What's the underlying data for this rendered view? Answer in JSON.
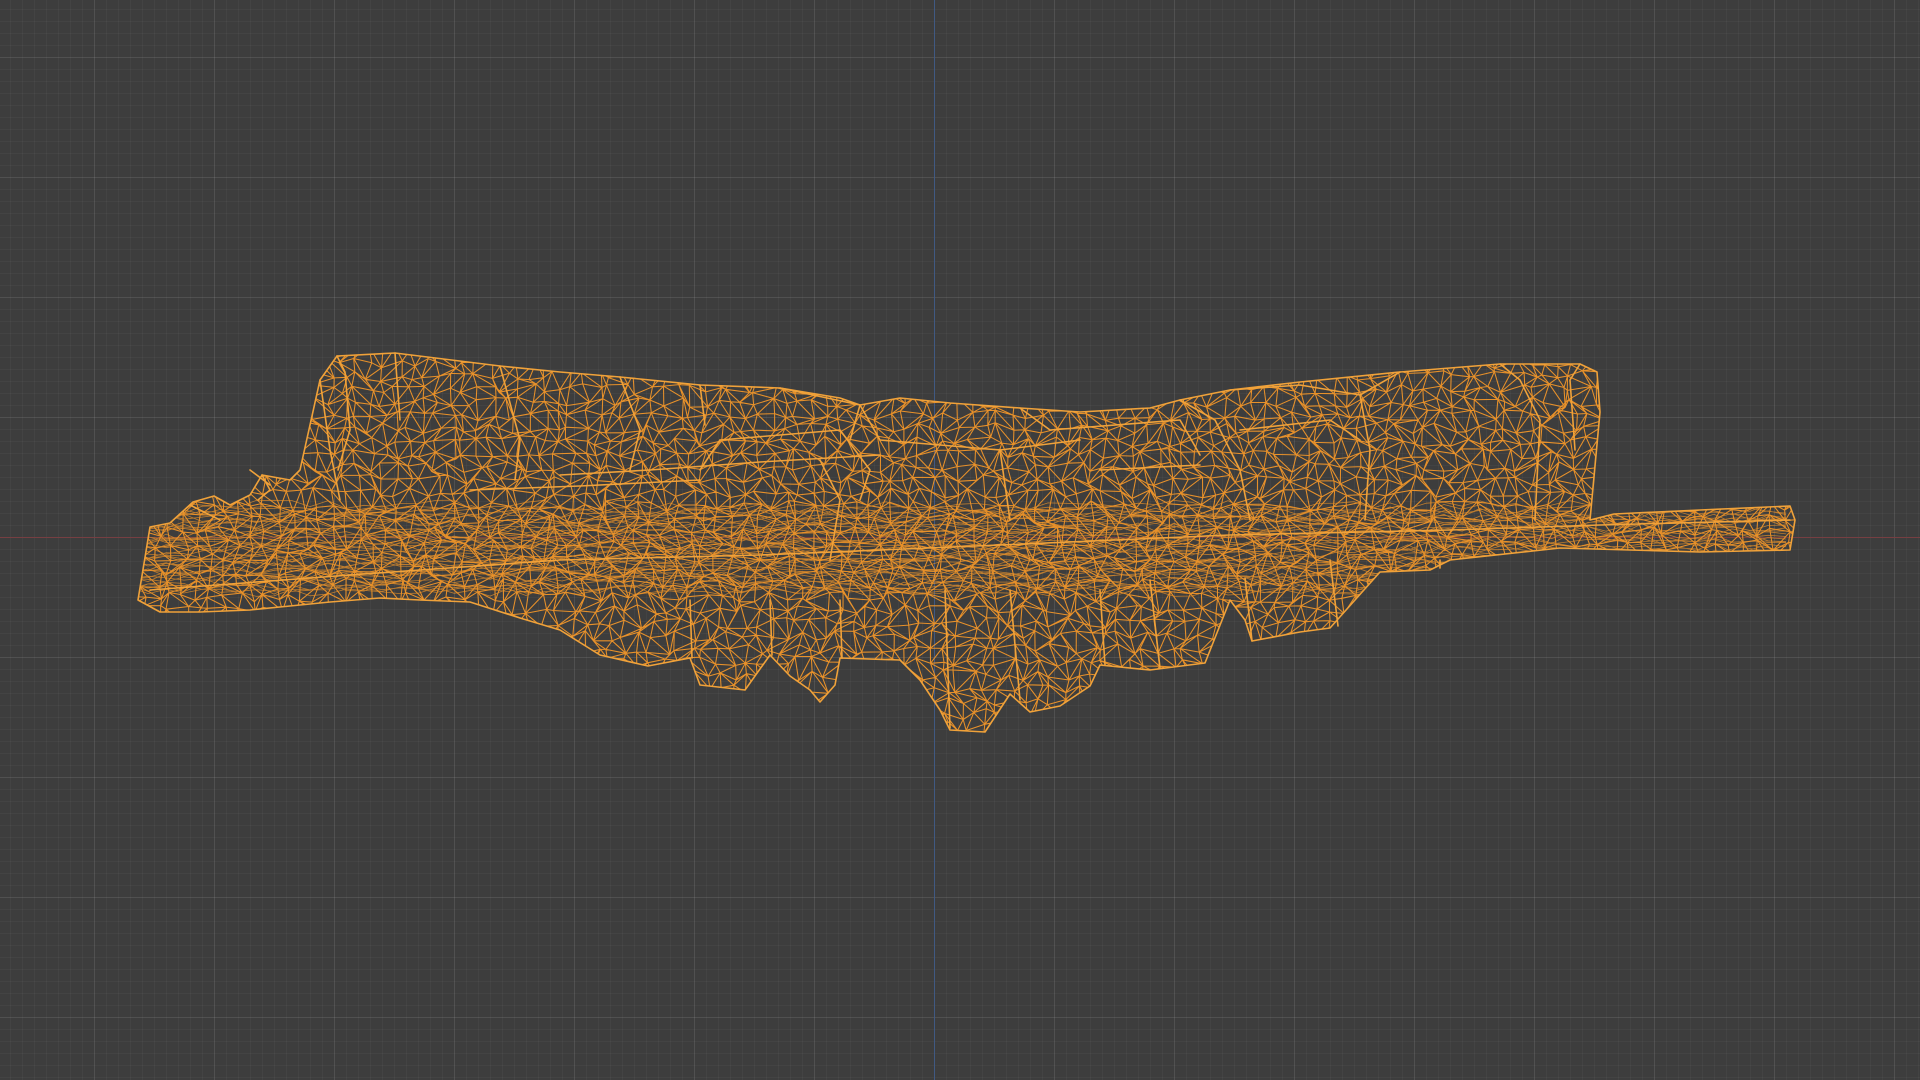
{
  "viewport": {
    "background_color": "#3d3d3d",
    "grid_color": "#4a4a4a",
    "x_axis_color": "#7a3d40",
    "y_axis_color": "#3f5a85"
  },
  "object": {
    "display_mode": "wireframe",
    "selected": true,
    "wire_color": "#e8912a"
  }
}
